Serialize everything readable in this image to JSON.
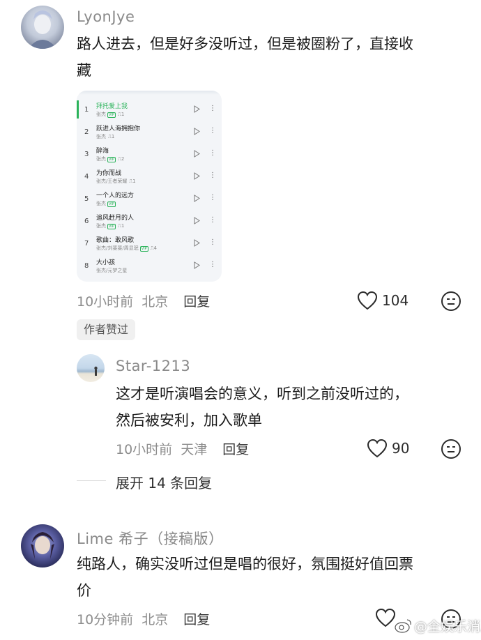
{
  "comments": [
    {
      "username": "LyonJye",
      "text_line1": "路人进去，但是好多没听过，但是被圈粉了，直接收",
      "text_line2": "藏",
      "time": "10小时前",
      "location": "北京",
      "reply_label": "回复",
      "likes": "104",
      "author_badge": "作者赞过",
      "playlist": [
        {
          "num": "1",
          "title": "拜托爱上我",
          "artist": "张杰",
          "vip": true,
          "count": "1",
          "active": true
        },
        {
          "num": "2",
          "title": "跃进人海拥抱你",
          "artist": "张杰",
          "vip": false,
          "count": "1",
          "active": false
        },
        {
          "num": "3",
          "title": "醉海",
          "artist": "张杰",
          "vip": true,
          "count": "2",
          "active": false
        },
        {
          "num": "4",
          "title": "为你而战",
          "artist": "张杰/王者荣耀",
          "vip": false,
          "count": "1",
          "active": false
        },
        {
          "num": "5",
          "title": "一个人的远方",
          "artist": "张杰",
          "vip": true,
          "count": "",
          "active": false
        },
        {
          "num": "6",
          "title": "追风赶月的人",
          "artist": "张杰",
          "vip": true,
          "count": "1",
          "active": false
        },
        {
          "num": "7",
          "title": "歌曲：敢风歌",
          "artist": "张杰/刘斐斐/周显珉",
          "vip": true,
          "count": "4",
          "active": false
        },
        {
          "num": "8",
          "title": "大小孩",
          "artist": "张杰/元梦之星",
          "vip": false,
          "count": "",
          "active": false
        }
      ]
    },
    {
      "username": "Star-1213",
      "text_line1": "这才是听演唱会的意义，听到之前没听过的，",
      "text_line2": "然后被安利，加入歌单",
      "time": "10小时前",
      "location": "天津",
      "reply_label": "回复",
      "likes": "90"
    },
    {
      "username": "Lime 希子（接稿版）",
      "text_line1": "纯路人，确实没听过但是唱的很好，氛围挺好值回票",
      "text_line2": "价",
      "time": "10分钟前",
      "location": "北京",
      "reply_label": "回复"
    }
  ],
  "expand_replies": "展开 14 条回复",
  "watermark": "@全娱乐消息",
  "icons": {
    "like": "heart-outline-icon",
    "emoji": "neutral-face-icon",
    "play": "play-next-icon",
    "more": "vertical-dots-icon"
  },
  "colors": {
    "accent_green": "#2bb35a",
    "meta_gray": "#8d8d8d"
  }
}
